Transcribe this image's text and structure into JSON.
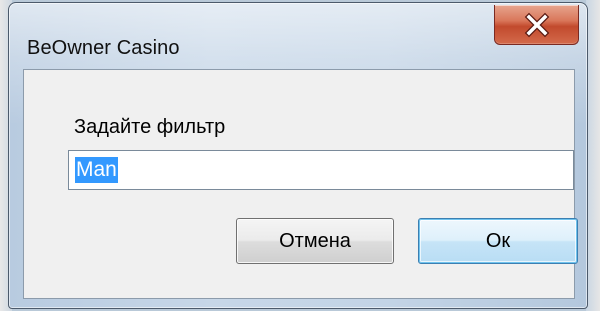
{
  "window": {
    "title": "BeOwner Casino",
    "close_icon": "close-icon"
  },
  "dialog": {
    "prompt": "Задайте фильтр",
    "filter_value": "Man",
    "cancel_label": "Отмена",
    "ok_label": "Ок"
  },
  "colors": {
    "title_bar": "#c3d4e6",
    "close_button": "#c24a2d",
    "selection": "#3399ff",
    "default_button_border": "#3c7fb1"
  }
}
